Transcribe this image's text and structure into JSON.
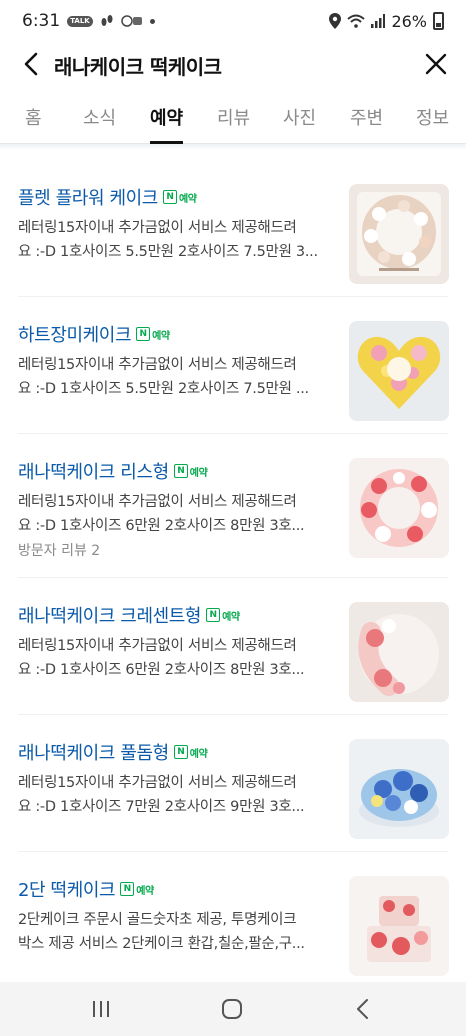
{
  "status_bar": {
    "time": "6:31",
    "notif_talk": "TALK",
    "battery": "26%"
  },
  "header": {
    "title": "래나케이크 떡케이크"
  },
  "tabs": [
    {
      "label": "홈",
      "active": false
    },
    {
      "label": "소식",
      "active": false
    },
    {
      "label": "예약",
      "active": true
    },
    {
      "label": "리뷰",
      "active": false
    },
    {
      "label": "사진",
      "active": false
    },
    {
      "label": "주변",
      "active": false
    },
    {
      "label": "정보",
      "active": false
    }
  ],
  "booking_badge": "예약",
  "items": [
    {
      "title": "플렛 플라워 케이크",
      "desc1": "레터링15자이내 추가금없이 서비스 제공해드려",
      "desc2": "요 :-D 1호사이즈 5.5만원 2호사이즈 7.5만원 3...",
      "review": "",
      "thumb_colors": [
        "#f5e9df",
        "#e8d2c2",
        "#f8f4f0"
      ]
    },
    {
      "title": "하트장미케이크",
      "desc1": "레터링15자이내 추가금없이 서비스 제공해드려",
      "desc2": "요 :-D 1호사이즈 5.5만원 2호사이즈 7.5만원 ...",
      "review": "",
      "thumb_colors": [
        "#f3d34a",
        "#f2a0b5",
        "#e9ecef"
      ]
    },
    {
      "title": "래나떡케이크 리스형",
      "desc1": "레터링15자이내 추가금없이 서비스 제공해드려",
      "desc2": "요 :-D 1호사이즈 6만원 2호사이즈 8만원 3호...",
      "review": "방문자 리뷰 2",
      "thumb_colors": [
        "#e85b63",
        "#f7c8c5",
        "#f6f1ee"
      ]
    },
    {
      "title": "래나떡케이크 크레센트형",
      "desc1": "레터링15자이내 추가금없이 서비스 제공해드려",
      "desc2": "요 :-D 1호사이즈 6만원 2호사이즈 8만원 3호...",
      "review": "",
      "thumb_colors": [
        "#e9787d",
        "#f4c8c4",
        "#efe9e6"
      ]
    },
    {
      "title": "래나떡케이크 풀돔형",
      "desc1": "레터링15자이내 추가금없이 서비스 제공해드려",
      "desc2": "요 :-D 1호사이즈 7만원 2호사이즈 9만원 3호...",
      "review": "",
      "thumb_colors": [
        "#3d6fc9",
        "#9dc6e8",
        "#eef1f3"
      ]
    },
    {
      "title": "2단 떡케이크",
      "desc1": "2단케이크 주문시 골드숫자초 제공, 투명케이크",
      "desc2": "박스 제공 서비스 2단케이크 환갑,칠순,팔순,구...",
      "review": "",
      "thumb_colors": [
        "#e35a5e",
        "#f1d2cd",
        "#f7f3f1"
      ]
    }
  ]
}
